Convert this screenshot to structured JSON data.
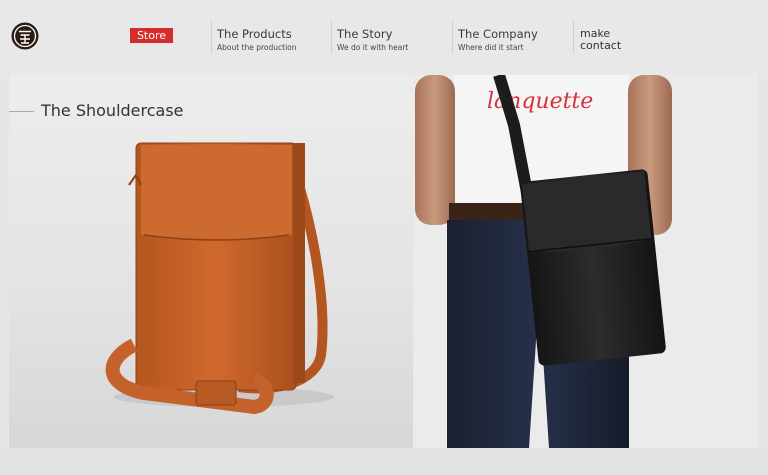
{
  "nav": {
    "store_label": "Store",
    "items": [
      {
        "title": "The Products",
        "subtitle": "About the production"
      },
      {
        "title": "The Story",
        "subtitle": "We do it with heart"
      },
      {
        "title": "The Company",
        "subtitle": "Where did it start"
      }
    ],
    "contact_line1": "make",
    "contact_line2": "contact"
  },
  "hero": {
    "title": "The Shouldercase",
    "tshirt_text": "lanquette"
  },
  "colors": {
    "accent": "#d42d2b",
    "leather_tan": "#c8622a",
    "leather_black": "#1e1e1e"
  }
}
